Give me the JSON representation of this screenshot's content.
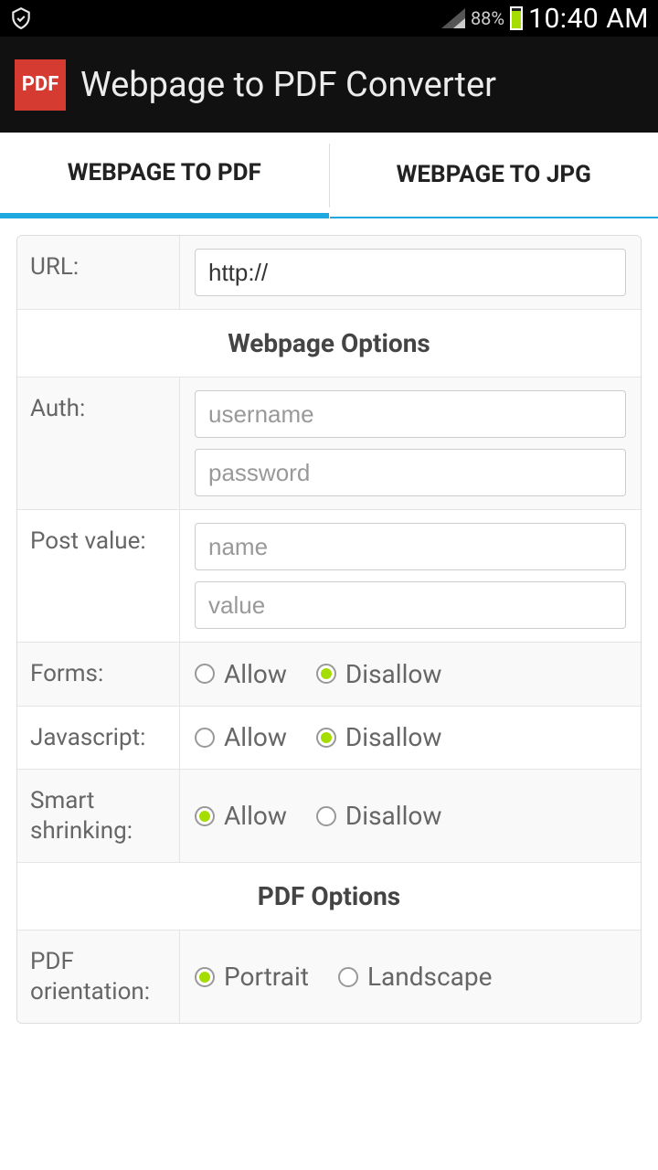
{
  "status": {
    "battery_percent": "88%",
    "time": "10:40 AM",
    "battery_fill_pct": 88
  },
  "app": {
    "icon_text": "PDF",
    "title": "Webpage to PDF Converter"
  },
  "tabs": [
    {
      "label": "WEBPAGE TO PDF",
      "active": true
    },
    {
      "label": "WEBPAGE TO JPG",
      "active": false
    }
  ],
  "form": {
    "url": {
      "label": "URL:",
      "value": "http://"
    },
    "section_webpage": "Webpage Options",
    "auth": {
      "label": "Auth:",
      "username_ph": "username",
      "password_ph": "password"
    },
    "post": {
      "label": "Post value:",
      "name_ph": "name",
      "value_ph": "value"
    },
    "forms": {
      "label": "Forms:",
      "allow": "Allow",
      "disallow": "Disallow",
      "selected": "disallow"
    },
    "javascript": {
      "label": "Javascript:",
      "allow": "Allow",
      "disallow": "Disallow",
      "selected": "disallow"
    },
    "shrinking": {
      "label": "Smart shrinking:",
      "allow": "Allow",
      "disallow": "Disallow",
      "selected": "allow"
    },
    "section_pdf": "PDF Options",
    "orientation": {
      "label": "PDF orientation:",
      "portrait": "Portrait",
      "landscape": "Landscape",
      "selected": "portrait"
    }
  }
}
